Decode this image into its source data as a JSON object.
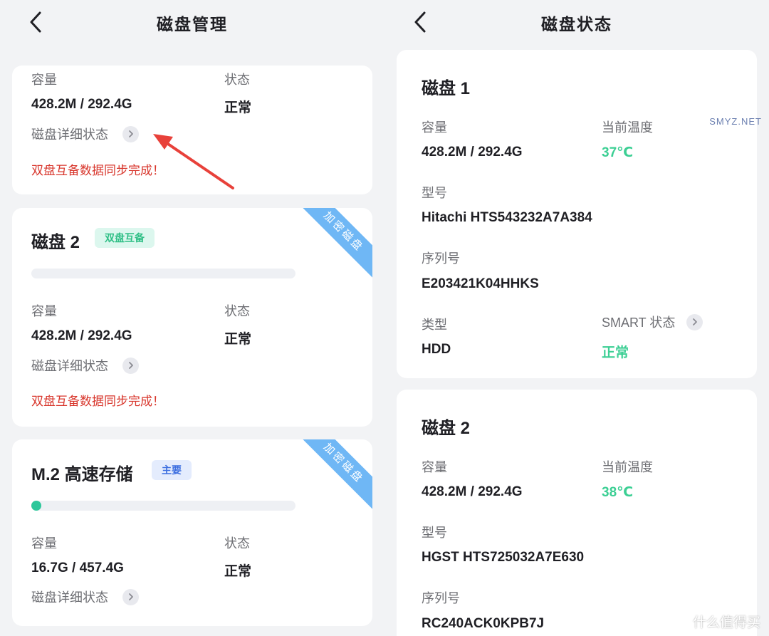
{
  "left": {
    "title": "磁盘管理",
    "card_top": {
      "capacity_label": "容量",
      "capacity_value": "428.2M / 292.4G",
      "status_label": "状态",
      "status_value": "正常",
      "detail_link": "磁盘详细状态",
      "sync_message": "双盘互备数据同步完成！"
    },
    "card_disk2": {
      "name": "磁盘 2",
      "tag": "双盘互备",
      "ribbon": "加密磁盘",
      "usage_fraction": 0.0,
      "capacity_label": "容量",
      "capacity_value": "428.2M / 292.4G",
      "status_label": "状态",
      "status_value": "正常",
      "detail_link": "磁盘详细状态",
      "sync_message": "双盘互备数据同步完成！"
    },
    "card_m2": {
      "name": "M.2 高速存储",
      "tag": "主要",
      "ribbon": "加密磁盘",
      "usage_fraction": 0.036,
      "capacity_label": "容量",
      "capacity_value": "16.7G / 457.4G",
      "status_label": "状态",
      "status_value": "正常",
      "detail_link": "磁盘详细状态"
    }
  },
  "right": {
    "title": "磁盘状态",
    "disk1": {
      "name": "磁盘 1",
      "capacity_label": "容量",
      "capacity_value": "428.2M / 292.4G",
      "temp_label": "当前温度",
      "temp_value": "37℃",
      "model_label": "型号",
      "model_value": "Hitachi HTS543232A7A384",
      "serial_label": "序列号",
      "serial_value": "E203421K04HHKS",
      "type_label": "类型",
      "type_value": "HDD",
      "smart_label": "SMART 状态",
      "smart_value": "正常"
    },
    "disk2": {
      "name": "磁盘 2",
      "capacity_label": "容量",
      "capacity_value": "428.2M / 292.4G",
      "temp_label": "当前温度",
      "temp_value": "38℃",
      "model_label": "型号",
      "model_value": "HGST HTS725032A7E630",
      "serial_label": "序列号",
      "serial_value": "RC240ACK0KPB7J"
    }
  },
  "watermark": {
    "text": "什么值得买",
    "site": "SMYZ.NET"
  },
  "colors": {
    "accent_green": "#3ccf94",
    "alert_red": "#d8362c",
    "ribbon_blue": "#6fb7f5",
    "arrow_red": "#e8413a"
  }
}
